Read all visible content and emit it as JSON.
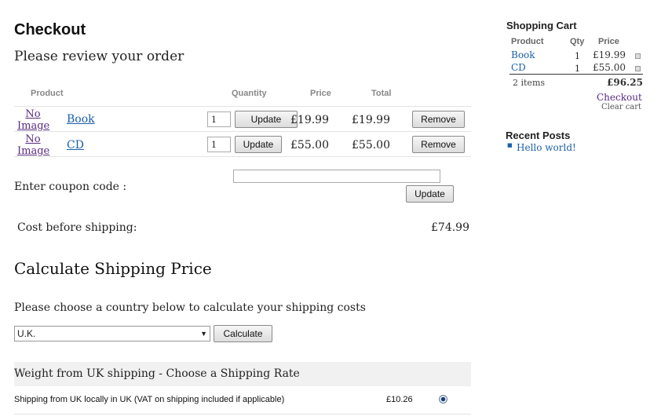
{
  "checkout": {
    "title": "Checkout",
    "subtitle": "Please review your order",
    "headers": {
      "product": "Product",
      "quantity": "Quantity",
      "price": "Price",
      "total": "Total"
    },
    "items": [
      {
        "image_alt": "No Image",
        "name": "Book",
        "qty": "1",
        "update": "Update",
        "price": "£19.99",
        "total": "£19.99",
        "remove": "Remove"
      },
      {
        "image_alt": "No Image",
        "name": "CD",
        "qty": "1",
        "update": "Update",
        "price": "£55.00",
        "total": "£55.00",
        "remove": "Remove"
      }
    ],
    "coupon_label": "Enter coupon code :",
    "coupon_value": "",
    "coupon_button": "Update",
    "cost_label": "Cost before shipping:",
    "cost_value": "£74.99"
  },
  "shipping": {
    "title": "Calculate Shipping Price",
    "prompt": "Please choose a country below to calculate your shipping costs",
    "country": "U.K.",
    "calculate": "Calculate",
    "rate_header": "Weight from UK shipping - Choose a Shipping Rate",
    "rates": [
      {
        "label": "Shipping from UK locally in UK (VAT on shipping included if applicable)",
        "price": "£10.26",
        "selected": true
      }
    ]
  },
  "cart": {
    "title": "Shopping Cart",
    "headers": {
      "product": "Product",
      "qty": "Qty",
      "price": "Price"
    },
    "items": [
      {
        "name": "Book",
        "qty": "1",
        "price": "£19.99"
      },
      {
        "name": "CD",
        "qty": "1",
        "price": "£55.00"
      }
    ],
    "count": "2 items",
    "total": "£96.25",
    "checkout": "Checkout",
    "clear": "Clear cart"
  },
  "recent_posts": {
    "title": "Recent Posts",
    "items": [
      "Hello world!"
    ]
  },
  "colors": {
    "link": "#1a5faa",
    "visited": "#5a2a82",
    "rate_band": "#f1f1f1"
  }
}
